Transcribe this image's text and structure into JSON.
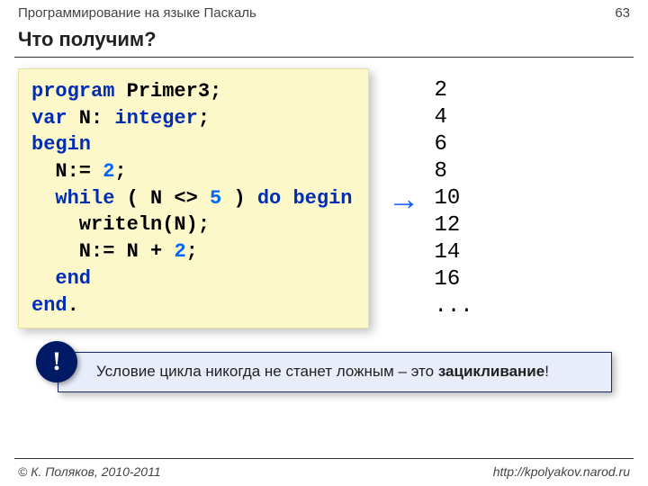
{
  "header": {
    "subject": "Программирование на языке Паскаль",
    "page_number": "63"
  },
  "title": "Что получим?",
  "code": {
    "tokens": [
      [
        {
          "t": "program",
          "c": "kw"
        },
        {
          "t": " Primer3;",
          "c": ""
        }
      ],
      [
        {
          "t": "var",
          "c": "kw"
        },
        {
          "t": " N: ",
          "c": ""
        },
        {
          "t": "integer",
          "c": "kw"
        },
        {
          "t": ";",
          "c": ""
        }
      ],
      [
        {
          "t": "begin",
          "c": "kw"
        }
      ],
      [
        {
          "t": "  N:= ",
          "c": ""
        },
        {
          "t": "2",
          "c": "num"
        },
        {
          "t": ";",
          "c": ""
        }
      ],
      [
        {
          "t": "  ",
          "c": ""
        },
        {
          "t": "while",
          "c": "kw"
        },
        {
          "t": " ( N <> ",
          "c": ""
        },
        {
          "t": "5",
          "c": "num"
        },
        {
          "t": " ) ",
          "c": ""
        },
        {
          "t": "do begin",
          "c": "kw"
        }
      ],
      [
        {
          "t": "    writeln(N);",
          "c": ""
        }
      ],
      [
        {
          "t": "    N:= N + ",
          "c": ""
        },
        {
          "t": "2",
          "c": "num"
        },
        {
          "t": ";",
          "c": ""
        }
      ],
      [
        {
          "t": "  ",
          "c": ""
        },
        {
          "t": "end",
          "c": "kw"
        }
      ],
      [
        {
          "t": "end",
          "c": "kw"
        },
        {
          "t": ".",
          "c": ""
        }
      ]
    ]
  },
  "arrow_symbol": "→",
  "output_lines": [
    "2",
    "4",
    "6",
    "8",
    "10",
    "12",
    "14",
    "16",
    "..."
  ],
  "note": {
    "bang": "!",
    "text_plain": "Условие цикла никогда не станет ложным – это ",
    "text_em": "зацикливание",
    "text_tail": "!"
  },
  "footer": {
    "copyright": "© К. Поляков, 2010-2011",
    "url": "http://kpolyakov.narod.ru"
  }
}
